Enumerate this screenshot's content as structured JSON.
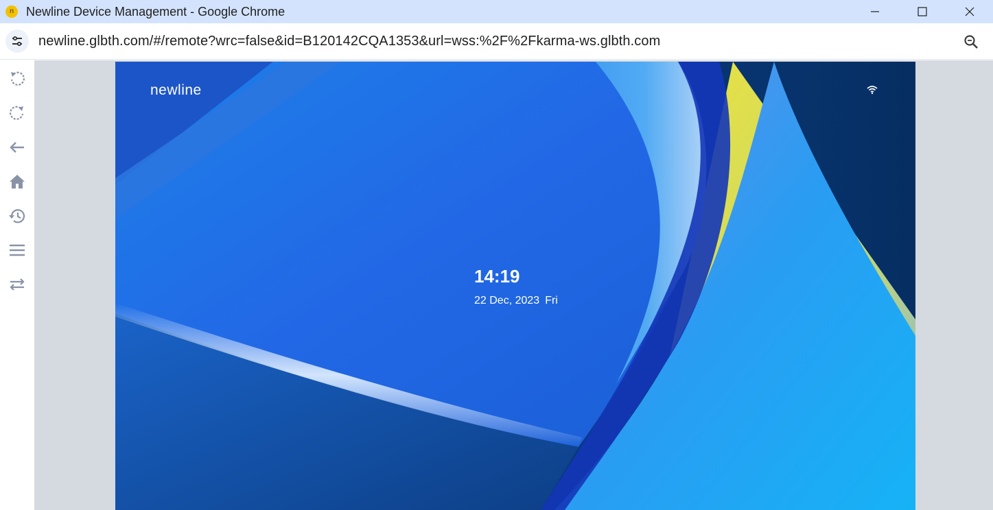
{
  "window": {
    "title": "Newline Device Management - Google Chrome",
    "app_icon": "chrome-app-icon"
  },
  "window_controls": [
    "minimize-icon",
    "maximize-icon",
    "close-icon"
  ],
  "addressbar": {
    "site_info_icon": "tune-icon",
    "url": "newline.glbth.com/#/remote?wrc=false&id=B120142CQA1353&url=wss:%2F%2Fkarma-ws.glbth.com",
    "zoom_icon": "zoom-icon"
  },
  "sidebar": {
    "items": [
      {
        "name": "rotate-left-icon"
      },
      {
        "name": "rotate-right-icon"
      },
      {
        "name": "back-arrow-icon"
      },
      {
        "name": "home-icon"
      },
      {
        "name": "history-icon"
      },
      {
        "name": "menu-icon"
      },
      {
        "name": "switch-icon"
      }
    ]
  },
  "remote_screen": {
    "brand": "newline",
    "time": "14:19",
    "date": "22 Dec, 2023",
    "weekday": "Fri",
    "wifi_icon": "wifi-icon"
  },
  "colors": {
    "titlebar": "#d3e3fd",
    "content_bg": "#d5d9e0",
    "screen_blue": "#1a6fe0",
    "accent_yellow": "#e8e33a",
    "navy": "#0a3b7a"
  }
}
